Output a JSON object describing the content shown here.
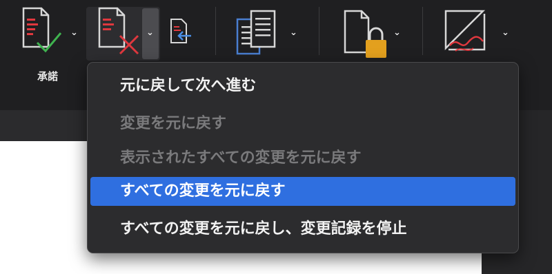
{
  "toolbar": {
    "accept_label": "承諾",
    "icons": [
      "accept-icon",
      "reject-icon",
      "next-change-icon",
      "compare-icon",
      "protect-icon",
      "ink-icon"
    ]
  },
  "reject_menu": {
    "items": [
      {
        "label": "元に戻して次へ進む",
        "enabled": true,
        "selected": false
      },
      {
        "label": "変更を元に戻す",
        "enabled": false,
        "selected": false
      },
      {
        "label": "表示されたすべての変更を元に戻す",
        "enabled": false,
        "selected": false
      },
      {
        "label": "すべての変更を元に戻す",
        "enabled": true,
        "selected": true
      },
      {
        "label": "すべての変更を元に戻し、変更記録を停止",
        "enabled": true,
        "selected": false
      }
    ]
  },
  "colors": {
    "selection": "#2f6fe0",
    "accept_check": "#3fb34f",
    "reject_x": "#e0383e",
    "lock": "#e3a01e",
    "compare_doc": "#4a7fd1"
  }
}
